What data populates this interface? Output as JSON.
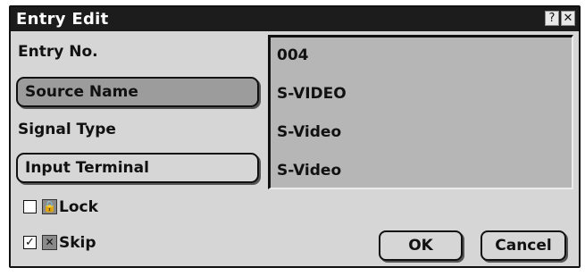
{
  "window": {
    "title": "Entry Edit",
    "help_glyph": "?",
    "close_glyph": "✕"
  },
  "fields": {
    "entry_no_label": "Entry No.",
    "source_name_label": "Source Name",
    "signal_type_label": "Signal Type",
    "input_terminal_label": "Input Terminal"
  },
  "values": {
    "entry_no": "004",
    "source_name": "S-VIDEO",
    "signal_type": "S-Video",
    "input_terminal": "S-Video"
  },
  "options": {
    "lock": {
      "label": "Lock",
      "checked": false,
      "check_mark": "",
      "icon": "lock-icon",
      "icon_glyph": "🔒"
    },
    "skip": {
      "label": "Skip",
      "checked": true,
      "check_mark": "✓",
      "icon": "skip-icon",
      "icon_glyph": "✕"
    }
  },
  "buttons": {
    "ok_label": "OK",
    "cancel_label": "Cancel"
  },
  "colors": {
    "titlebar": "#1c1c1c",
    "dialog_bg": "#d6d6d6",
    "value_box_bg": "#b6b6b6",
    "active_button_bg": "#9c9c9c"
  }
}
